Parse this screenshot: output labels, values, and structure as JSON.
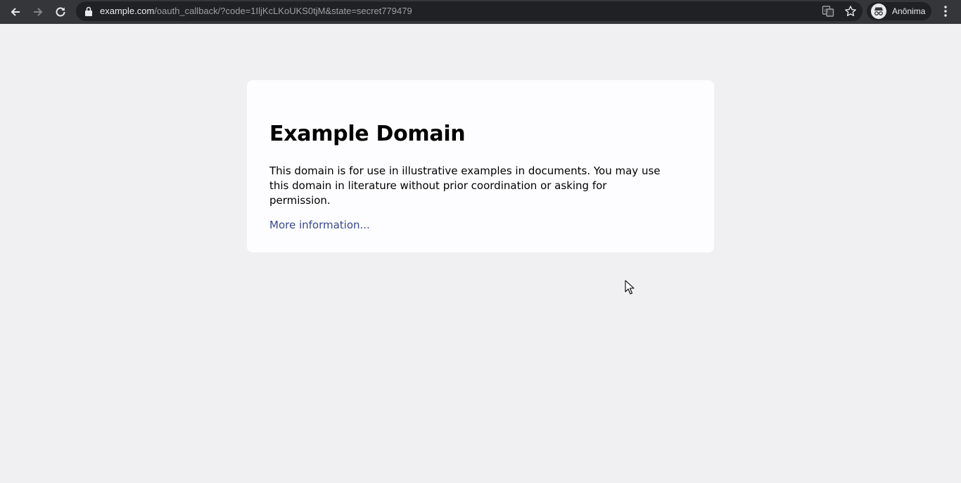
{
  "browser": {
    "url_host": "example.com",
    "url_path": "/oauth_callback/?code=1IljKcLKoUKS0tjM&state=secret779479",
    "profile_label": "Anônima"
  },
  "page": {
    "heading": "Example Domain",
    "description": "This domain is for use in illustrative examples in documents. You may use this domain in literature without prior coordination or asking for permission.",
    "link_label": "More information..."
  },
  "colors": {
    "toolbar": "#35363a",
    "omnibox": "#202124",
    "page_background": "#f0f0f2",
    "card_background": "#fdfdff",
    "link": "#38488f"
  },
  "icons": [
    "back-arrow-icon",
    "forward-arrow-icon",
    "reload-icon",
    "lock-icon",
    "translate-icon",
    "star-icon",
    "incognito-icon",
    "kebab-menu-icon",
    "mouse-cursor-icon"
  ]
}
